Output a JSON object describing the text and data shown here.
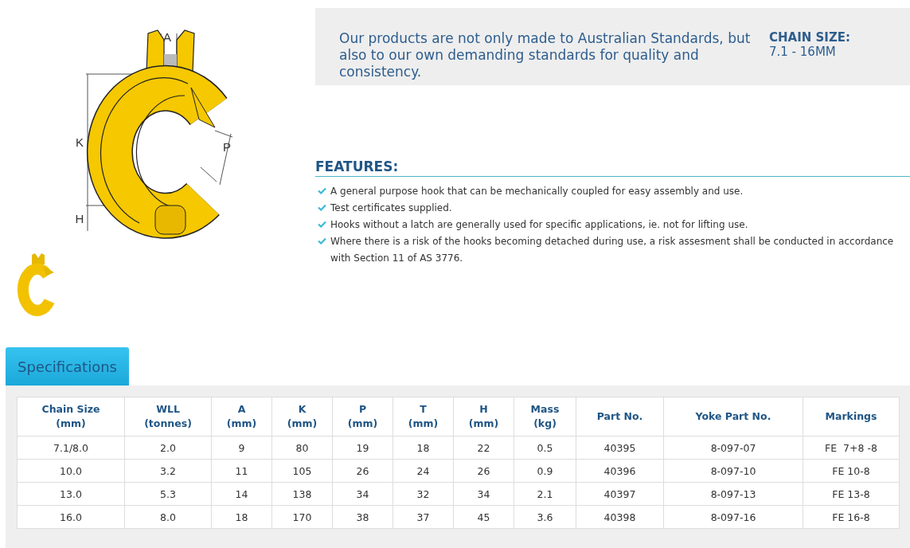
{
  "diagram_labels": [
    "A",
    "K",
    "P",
    "H"
  ],
  "intro": "Our products are not only made to Australian Standards, but also to our own demanding standards for quality and consistency.",
  "chain_size": {
    "label": "CHAIN SIZE:",
    "value": "7.1 - 16MM"
  },
  "features": {
    "title": "FEATURES:",
    "items": [
      "A general purpose hook that can be mechanically coupled for easy assembly and use.",
      "Test certificates supplied.",
      "Hooks without a latch are generally used for specific applications, ie. not for lifting use.",
      "Where there is a risk of the hooks becoming detached during use, a risk assesment shall be conducted in accordance with Section 11 of AS 3776."
    ]
  },
  "tabs": [
    {
      "label": "Specifications",
      "selected": true
    }
  ],
  "table": {
    "columns": [
      {
        "label": "Chain Size",
        "unit": "(mm)"
      },
      {
        "label": "WLL",
        "unit": "(tonnes)"
      },
      {
        "label": "A",
        "unit": "(mm)"
      },
      {
        "label": "K",
        "unit": "(mm)"
      },
      {
        "label": "P",
        "unit": "(mm)"
      },
      {
        "label": "T",
        "unit": "(mm)"
      },
      {
        "label": "H",
        "unit": "(mm)"
      },
      {
        "label": "Mass",
        "unit": "(kg)"
      },
      {
        "label": "Part No."
      },
      {
        "label": "Yoke Part No."
      },
      {
        "label": "Markings"
      }
    ],
    "rows": [
      [
        "7.1/8.0",
        "2.0",
        "9",
        "80",
        "19",
        "18",
        "22",
        "0.5",
        "40395",
        "8-097-07",
        "FE  7+8 -8"
      ],
      [
        "10.0",
        "3.2",
        "11",
        "105",
        "26",
        "24",
        "26",
        "0.9",
        "40396",
        "8-097-10",
        "FE 10-8"
      ],
      [
        "13.0",
        "5.3",
        "14",
        "138",
        "34",
        "32",
        "34",
        "2.1",
        "40397",
        "8-097-13",
        "FE 13-8"
      ],
      [
        "16.0",
        "8.0",
        "18",
        "170",
        "38",
        "37",
        "45",
        "3.6",
        "40398",
        "8-097-16",
        "FE 16-8"
      ]
    ]
  }
}
